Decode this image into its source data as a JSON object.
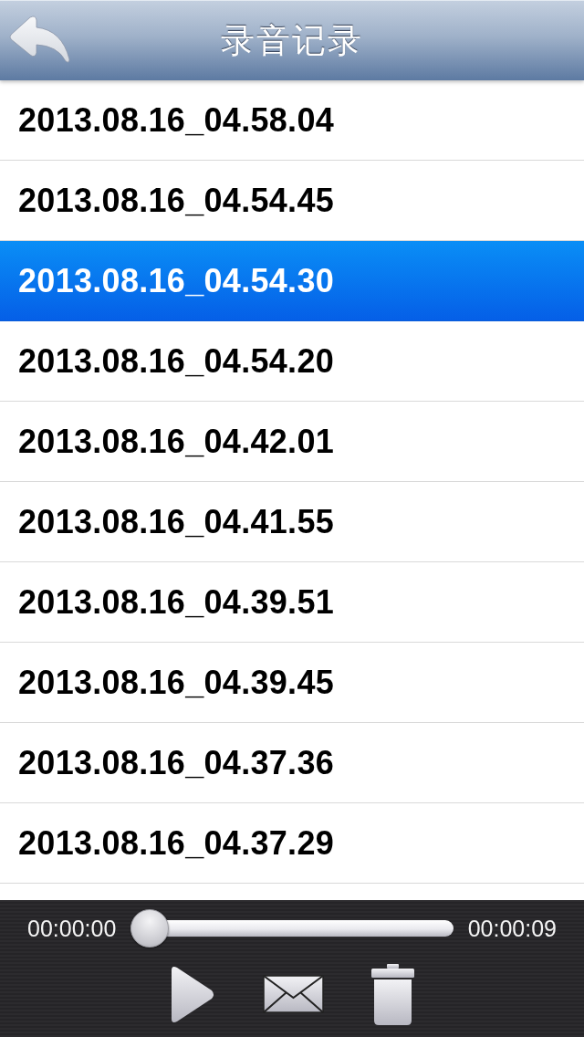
{
  "header": {
    "title": "录音记录"
  },
  "recordings": [
    {
      "name": "2013.08.16_04.58.04",
      "selected": false
    },
    {
      "name": "2013.08.16_04.54.45",
      "selected": false
    },
    {
      "name": "2013.08.16_04.54.30",
      "selected": true
    },
    {
      "name": "2013.08.16_04.54.20",
      "selected": false
    },
    {
      "name": "2013.08.16_04.42.01",
      "selected": false
    },
    {
      "name": "2013.08.16_04.41.55",
      "selected": false
    },
    {
      "name": "2013.08.16_04.39.51",
      "selected": false
    },
    {
      "name": "2013.08.16_04.39.45",
      "selected": false
    },
    {
      "name": "2013.08.16_04.37.36",
      "selected": false
    },
    {
      "name": "2013.08.16_04.37.29",
      "selected": false
    }
  ],
  "player": {
    "elapsed": "00:00:00",
    "slider": {
      "level": 0
    },
    "duration": "00:00:09"
  }
}
